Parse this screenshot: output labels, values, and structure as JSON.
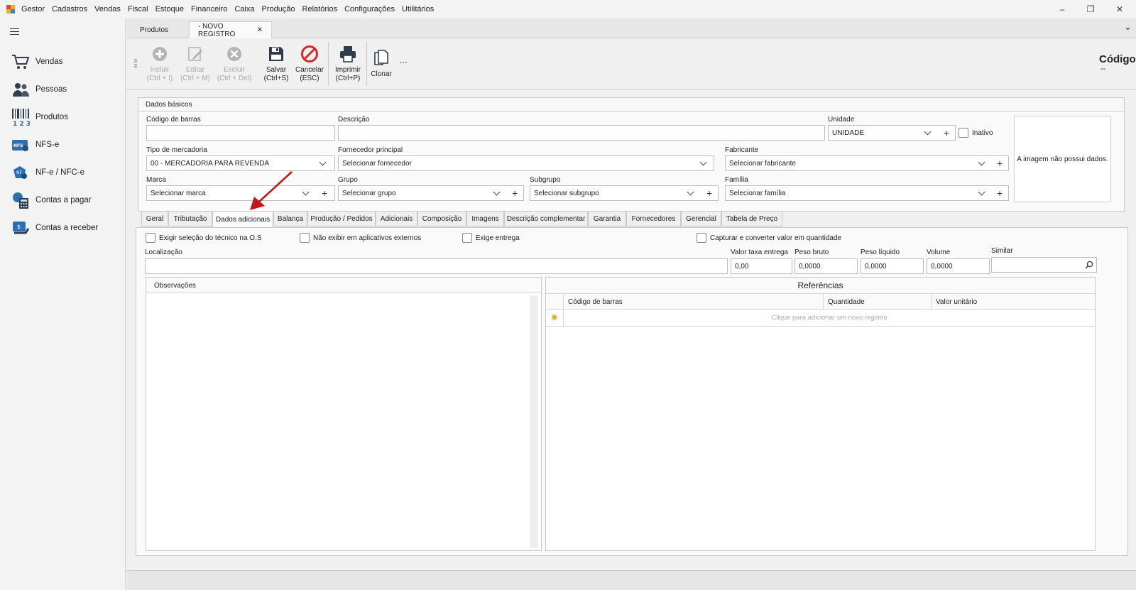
{
  "app": {
    "title": "Gestor"
  },
  "menu": [
    "Cadastros",
    "Vendas",
    "Fiscal",
    "Estoque",
    "Financeiro",
    "Caixa",
    "Produção",
    "Relatórios",
    "Configurações",
    "Utilitários"
  ],
  "window_controls": {
    "minimize": "–",
    "maximize": "❐",
    "close": "✕"
  },
  "sidebar": {
    "items": [
      {
        "label": "Vendas",
        "icon": "cart-icon"
      },
      {
        "label": "Pessoas",
        "icon": "people-icon"
      },
      {
        "label": "Produtos",
        "icon": "barcode-icon"
      },
      {
        "label": "NFS-e",
        "icon": "nfse-icon"
      },
      {
        "label": "NF-e / NFC-e",
        "icon": "nfe-icon"
      },
      {
        "label": "Contas a pagar",
        "icon": "calculator-icon"
      },
      {
        "label": "Contas a receber",
        "icon": "receivable-icon"
      }
    ]
  },
  "doc_tabs": {
    "tab1": "Produtos",
    "tab2": "- NOVO REGISTRO",
    "close": "✕",
    "overflow": "⌄"
  },
  "toolbar": {
    "incluir": {
      "line1": "Incluir",
      "line2": "(Ctrl + I)"
    },
    "editar": {
      "line1": "Editar",
      "line2": "(Ctrl + M)"
    },
    "excluir": {
      "line1": "Excluir",
      "line2": "(Ctrl + Del)"
    },
    "salvar": {
      "line1": "Salvar",
      "line2": "(Ctrl+S)"
    },
    "cancelar": {
      "line1": "Cancelar",
      "line2": "(ESC)"
    },
    "imprimir": {
      "line1": "Imprimir",
      "line2": "(Ctrl+P)"
    },
    "clonar": "Clonar",
    "more": "...",
    "codigo_title": "Código",
    "codigo_value": "--"
  },
  "basic": {
    "section_title": "Dados básicos",
    "codigo_barras_label": "Código de barras",
    "descricao_label": "Descrição",
    "unidade_label": "Unidade",
    "unidade_value": "UNIDADE",
    "inativo_label": "Inativo",
    "tipo_label": "Tipo de mercadoria",
    "tipo_value": "00 - MERCADORIA PARA REVENDA",
    "fornecedor_label": "Fornecedor principal",
    "fornecedor_value": "Selecionar fornecedor",
    "fabricante_label": "Fabricante",
    "fabricante_value": "Selecionar fabricante",
    "marca_label": "Marca",
    "marca_value": "Selecionar marca",
    "grupo_label": "Grupo",
    "grupo_value": "Selecionar grupo",
    "subgrupo_label": "Subgrupo",
    "subgrupo_value": "Selecionar subgrupo",
    "familia_label": "Família",
    "familia_value": "Selecionar família",
    "image_text": "A imagem não possui dados."
  },
  "tabs": [
    "Geral",
    "Tributação",
    "Dados adicionais",
    "Balança",
    "Produção / Pedidos",
    "Adicionais",
    "Composição",
    "Imagens",
    "Descrição complementar",
    "Garantia",
    "Fornecedores",
    "Gerencial",
    "Tabela de Preço"
  ],
  "active_tab": "Dados adicionais",
  "extra": {
    "chk_tecnico": "Exigir seleção do técnico na O.S",
    "chk_aplicativos": "Não exibir em aplicativos externos",
    "chk_entrega": "Exige entrega",
    "chk_capturar": "Capturar e converter valor em quantidade",
    "localizacao_label": "Localização",
    "taxa_label": "Valor taxa entrega",
    "taxa_value": "0,00",
    "peso_bruto_label": "Peso bruto",
    "peso_bruto_value": "0,0000",
    "peso_liquido_label": "Peso líquido",
    "peso_liquido_value": "0,0000",
    "volume_label": "Volume",
    "volume_value": "0,0000",
    "similar_label": "Similar",
    "observacoes_title": "Observações",
    "referencias_title": "Referências",
    "grid_headers": [
      "Código de barras",
      "Quantidade",
      "Valor unitário"
    ],
    "grid_new_row": "Clique para adicionar um novo registro"
  },
  "colors": {
    "accent_red": "#cc2222",
    "arrow": "#c0181b",
    "disabled": "#a9a9a9"
  }
}
